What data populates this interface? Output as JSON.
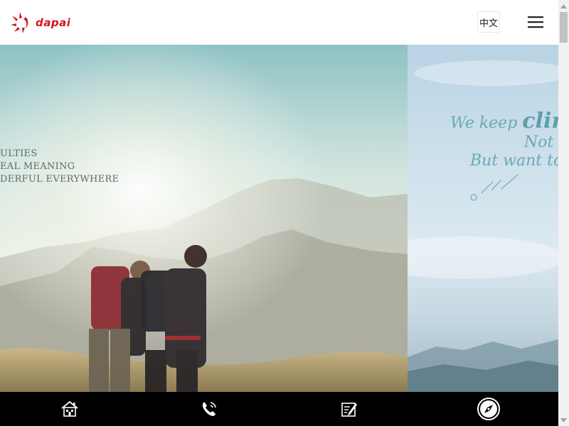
{
  "header": {
    "logo_text": "dapai",
    "lang_label": "中文",
    "menu_icon": "hamburger-menu-icon"
  },
  "colors": {
    "brand": "#d4141c",
    "caption_gray": "#5a6a6a",
    "caption_teal": "#6aaab6",
    "nav_bg": "#000000"
  },
  "hero": {
    "slide1": {
      "lines": [
        "ULTIES",
        "EAL MEANING",
        "DERFUL EVERYWHERE"
      ]
    },
    "slide2": {
      "line1_prefix": "We keep ",
      "line1_bold": "clim",
      "line2": "Not t",
      "line3": "But want to s"
    }
  },
  "bottom_nav": {
    "items": [
      {
        "icon": "home-icon"
      },
      {
        "icon": "phone-icon"
      },
      {
        "icon": "message-form-icon"
      },
      {
        "icon": "compass-icon"
      }
    ]
  }
}
